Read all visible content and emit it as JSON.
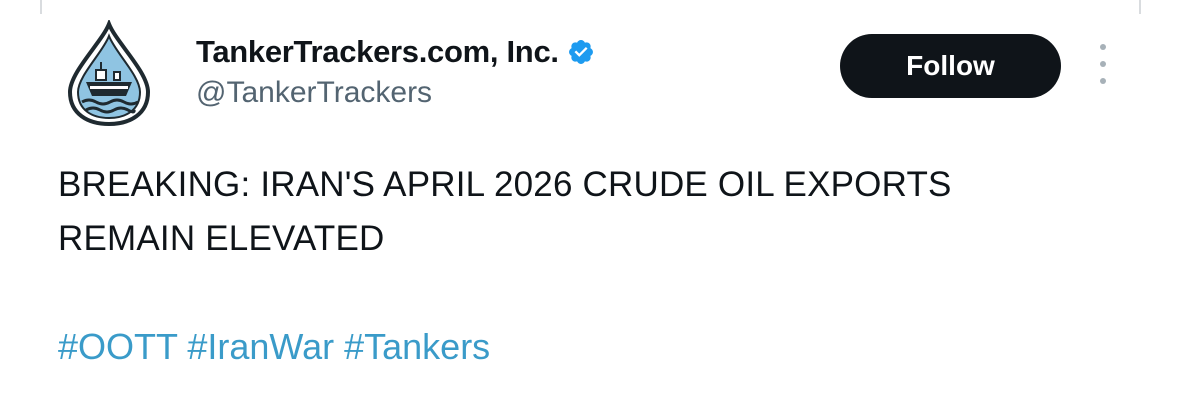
{
  "tweet": {
    "author": {
      "display_name": "TankerTrackers.com, Inc.",
      "handle": "@TankerTrackers",
      "verified": true,
      "avatar_icon": "oil-drop-tanker-logo"
    },
    "follow_label": "Follow",
    "more_icon": "vertical-ellipsis-icon",
    "text_lines": [
      "BREAKING: IRAN'S APRIL 2026 CRUDE OIL EXPORTS",
      "REMAIN ELEVATED"
    ],
    "hashtags": [
      "#OOTT",
      "#IranWar",
      "#Tankers"
    ]
  },
  "colors": {
    "text": "#0f1419",
    "handle": "#536471",
    "hashtag": "#3a9bc9",
    "verified_badge": "#1d9bf0",
    "follow_bg": "#0f1419"
  }
}
